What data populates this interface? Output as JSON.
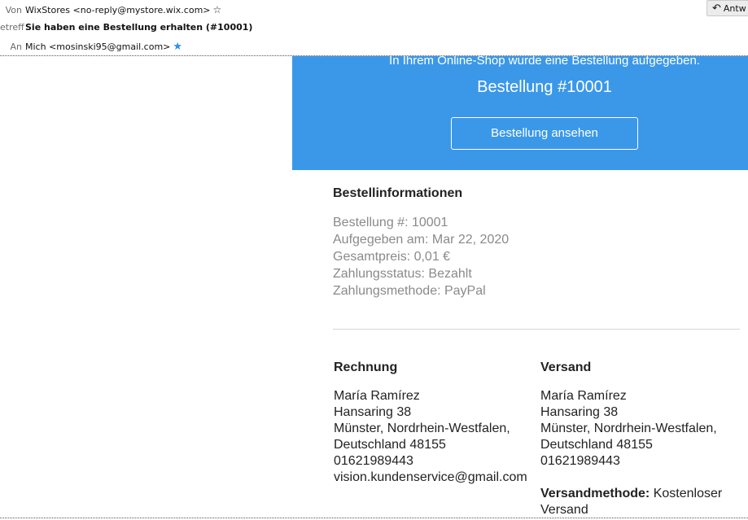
{
  "header": {
    "from_label": "Von",
    "from_value": "WixStores <no-reply@mystore.wix.com>",
    "subject_label": "etreff",
    "subject_value": "Sie haben eine Bestellung erhalten (#10001)",
    "to_label": "An",
    "to_value": "Mich <mosinski95@gmail.com>",
    "reply_label": "Antw"
  },
  "banner": {
    "intro": "In Ihrem Online-Shop wurde eine Bestellung aufgegeben.",
    "order_title": "Bestellung #10001",
    "button_label": "Bestellung ansehen",
    "color": "#3b98e8"
  },
  "order_info": {
    "title": "Bestellinformationen",
    "lines": [
      "Bestellung #: 10001",
      "Aufgegeben am: Mar 22, 2020",
      "Gesamtpreis: 0,01 €",
      "Zahlungsstatus: Bezahlt",
      "Zahlungsmethode: PayPal"
    ]
  },
  "billing": {
    "title": "Rechnung",
    "lines": [
      "María Ramírez",
      "Hansaring 38",
      "Münster, Nordrhein-Westfalen,",
      "Deutschland 48155",
      "01621989443",
      "vision.kundenservice@gmail.com"
    ]
  },
  "shipping": {
    "title": "Versand",
    "lines": [
      "María Ramírez",
      "Hansaring 38",
      "Münster, Nordrhein-Westfalen,",
      "Deutschland 48155",
      "01621989443"
    ],
    "method_label": "Versandmethode:",
    "method_value_1": " Kostenloser",
    "method_value_2": "Versand"
  },
  "icons": {
    "from_star": "star-outline-icon",
    "to_star": "star-filled-icon",
    "reply": "reply-arrow-icon"
  }
}
